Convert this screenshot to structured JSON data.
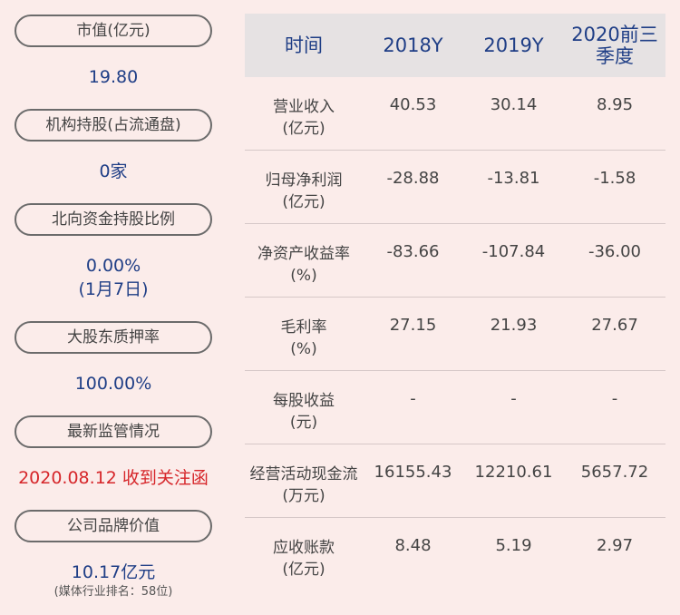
{
  "left": {
    "items": [
      {
        "label": "市值(亿元)",
        "value": "19.80"
      },
      {
        "label": "机构持股(占流通盘)",
        "value": "0家"
      },
      {
        "label": "北向资金持股比例",
        "value": "0.00%",
        "value2": "(1月7日)"
      },
      {
        "label": "大股东质押率",
        "value": "100.00%"
      },
      {
        "label": "最新监管情况",
        "value": "2020.08.12 收到关注函"
      },
      {
        "label": "公司品牌价值",
        "value": "10.17亿元",
        "note": "(媒体行业排名：58位)"
      }
    ]
  },
  "table": {
    "headers": [
      "时间",
      "2018Y",
      "2019Y",
      "2020前三季度"
    ],
    "rows": [
      {
        "label1": "营业收入",
        "label2": "(亿元)",
        "values": [
          "40.53",
          "30.14",
          "8.95"
        ]
      },
      {
        "label1": "归母净利润",
        "label2": "(亿元)",
        "values": [
          "-28.88",
          "-13.81",
          "-1.58"
        ]
      },
      {
        "label1": "净资产收益率",
        "label2": "(%)",
        "values": [
          "-83.66",
          "-107.84",
          "-36.00"
        ]
      },
      {
        "label1": "毛利率",
        "label2": "(%)",
        "values": [
          "27.15",
          "21.93",
          "27.67"
        ]
      },
      {
        "label1": "每股收益",
        "label2": "(元)",
        "values": [
          "-",
          "-",
          "-"
        ]
      },
      {
        "label1": "经营活动现金流",
        "label2": "(万元)",
        "values": [
          "16155.43",
          "12210.61",
          "5657.72"
        ]
      },
      {
        "label1": "应收账款",
        "label2": "(亿元)",
        "values": [
          "8.48",
          "5.19",
          "2.97"
        ]
      }
    ]
  },
  "colors": {
    "background": "#fbecea",
    "header_bg": "#e6e2e3",
    "value_blue": "#1f3e86",
    "alert_red": "#d6262a"
  }
}
